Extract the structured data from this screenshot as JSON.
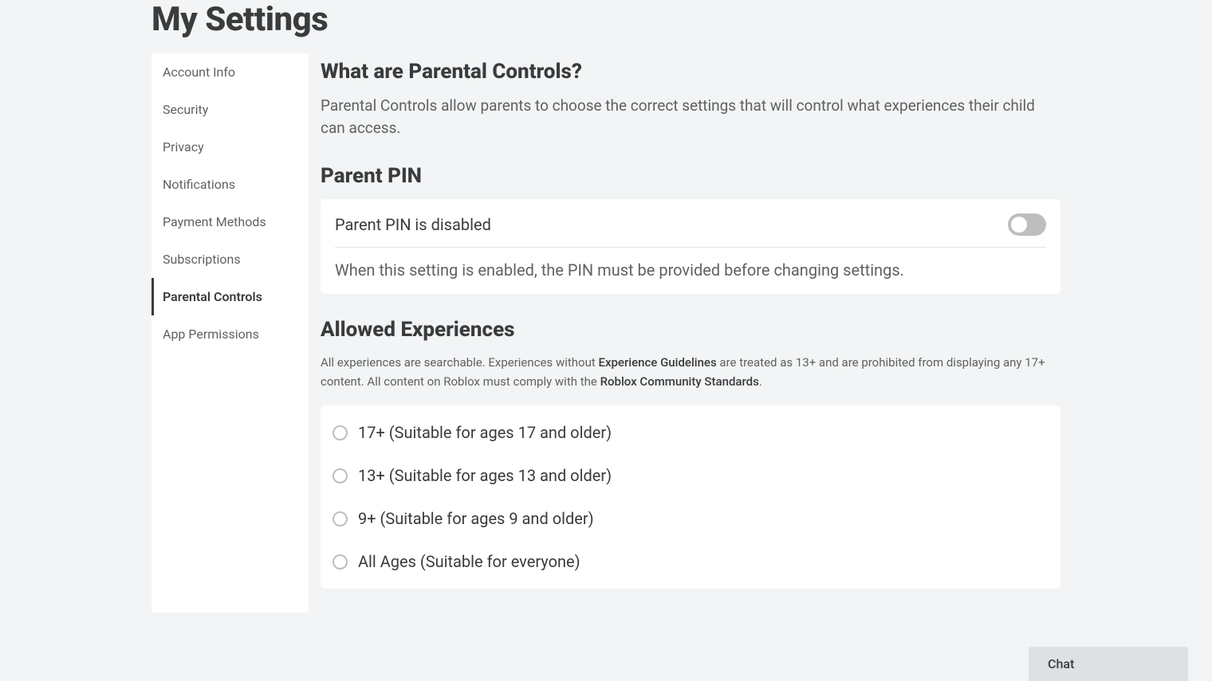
{
  "page_title": "My Settings",
  "sidebar": {
    "items": [
      {
        "label": "Account Info"
      },
      {
        "label": "Security"
      },
      {
        "label": "Privacy"
      },
      {
        "label": "Notifications"
      },
      {
        "label": "Payment Methods"
      },
      {
        "label": "Subscriptions"
      },
      {
        "label": "Parental Controls"
      },
      {
        "label": "App Permissions"
      }
    ],
    "active_index": 6
  },
  "section_what": {
    "title": "What are Parental Controls?",
    "body": "Parental Controls allow parents to choose the correct settings that will control what experiences their child can access."
  },
  "section_pin": {
    "title": "Parent PIN",
    "status_label": "Parent PIN is disabled",
    "enabled": false,
    "description": "When this setting is enabled, the PIN must be provided before changing settings."
  },
  "section_allowed": {
    "title": "Allowed Experiences",
    "info_prefix": "All experiences are searchable. Experiences without ",
    "info_link1": "Experience Guidelines",
    "info_middle": " are treated as 13+ and are prohibited from displaying any 17+ content. All content on Roblox must comply with the ",
    "info_link2": "Roblox Community Standards",
    "info_suffix": ".",
    "options": [
      {
        "label": "17+ (Suitable for ages 17 and older)"
      },
      {
        "label": "13+ (Suitable for ages 13 and older)"
      },
      {
        "label": "9+ (Suitable for ages 9 and older)"
      },
      {
        "label": "All Ages (Suitable for everyone)"
      }
    ]
  },
  "chat_label": "Chat"
}
